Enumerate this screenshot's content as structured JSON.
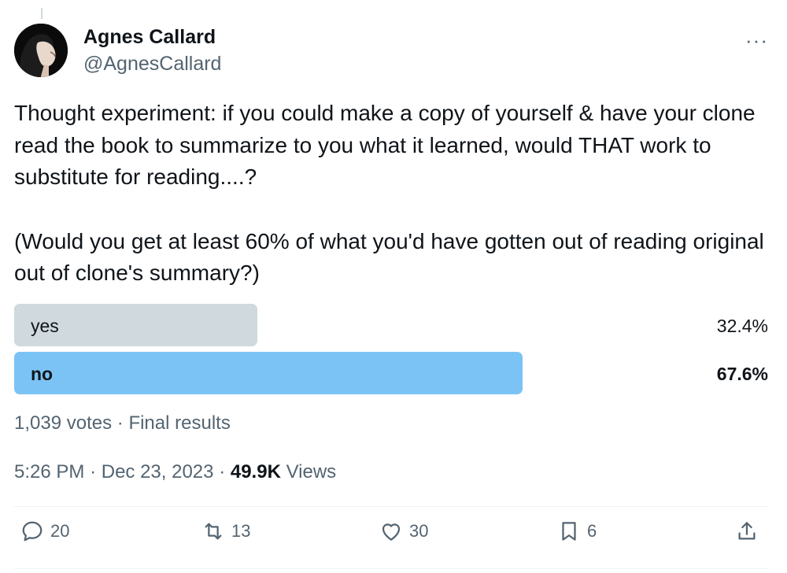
{
  "author": {
    "name": "Agnes Callard",
    "handle": "@AgnesCallard"
  },
  "icons": {
    "more": "more-horizontal-icon",
    "reply": "reply-icon",
    "retweet": "retweet-icon",
    "like": "heart-icon",
    "bookmark": "bookmark-icon",
    "share": "share-icon"
  },
  "more_label": "···",
  "tweet": {
    "paragraph1": "Thought experiment: if you could make a copy of yourself & have your clone read the book to summarize to you what it learned, would THAT work to substitute for reading....?",
    "paragraph2": "(Would you get at least 60% of what you'd have gotten out of reading original out of clone's summary?)"
  },
  "poll": {
    "options": [
      {
        "label": "yes",
        "percent_text": "32.4%",
        "fraction": 0.324,
        "color": "#cfd9de"
      },
      {
        "label": "no",
        "percent_text": "67.6%",
        "fraction": 0.676,
        "color": "#7cc3f5",
        "winner": true
      }
    ],
    "votes": "1,039 votes",
    "status": "Final results"
  },
  "meta": {
    "time": "5:26 PM",
    "date": "Dec 23, 2023",
    "views_count": "49.9K",
    "views_label": "Views"
  },
  "actions": {
    "replies": "20",
    "retweets": "13",
    "likes": "30",
    "bookmarks": "6"
  },
  "colors": {
    "text": "#0f1419",
    "secondary": "#536471",
    "winner_bar": "#7cc3f5",
    "loser_bar": "#cfd9de"
  }
}
